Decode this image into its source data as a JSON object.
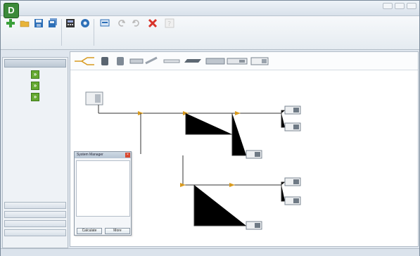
{
  "window": {
    "title": "",
    "home_tab": ""
  },
  "toolbar": {
    "buttons": [
      {
        "id": "new",
        "icon": "new-project-icon",
        "label": "",
        "color": "#3aa03a"
      },
      {
        "id": "open",
        "icon": "open-folder-icon",
        "label": "",
        "color": "#e0a62a"
      },
      {
        "id": "save",
        "icon": "save-icon",
        "label": "",
        "color": "#2d6fb7"
      },
      {
        "id": "saveas",
        "icon": "save-as-icon",
        "label": "",
        "color": "#2d6fb7"
      },
      {
        "id": "calculate",
        "icon": "calculator-icon",
        "label": "",
        "color": "#333333"
      },
      {
        "id": "system",
        "icon": "system-manager-icon",
        "label": "",
        "color": "#2d6fb7"
      },
      {
        "id": "language",
        "icon": "language-icon",
        "label": "",
        "color": "#2d6fb7"
      },
      {
        "id": "previous",
        "icon": "previous-icon",
        "label": "",
        "color": "#bbbbbb"
      },
      {
        "id": "next",
        "icon": "next-icon",
        "label": "",
        "color": "#bbbbbb"
      },
      {
        "id": "exit",
        "icon": "exit-icon",
        "label": "",
        "color": "#d8332a"
      },
      {
        "id": "help",
        "icon": "help-icon",
        "label": "",
        "color": "#cccccc"
      }
    ]
  },
  "left_panel": {
    "header": "",
    "steps": [
      {
        "label": ""
      },
      {
        "label": ""
      },
      {
        "label": ""
      }
    ],
    "bottom_buttons": [
      "",
      "",
      "",
      ""
    ]
  },
  "diagram": {
    "system_title": "",
    "outdoor_unit": {
      "rating": "",
      "model": ""
    },
    "pipe_segments": [],
    "indoor_units": []
  },
  "system_manager": {
    "title": "System Manager",
    "tree": [
      "",
      ""
    ],
    "indoor_unit_quantity_label": "",
    "combination_ratio_label": "",
    "calculate_label": "Calculate",
    "more_label": "More"
  }
}
